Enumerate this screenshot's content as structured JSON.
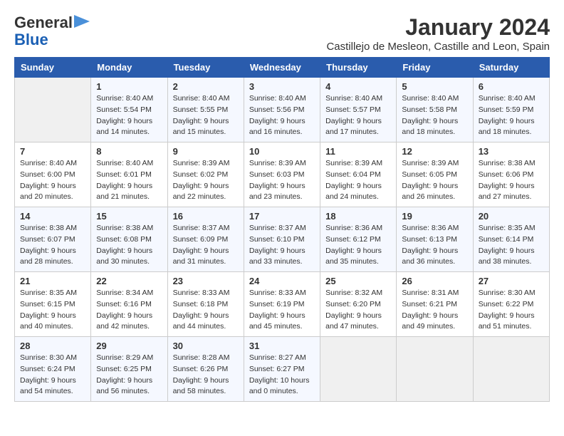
{
  "logo": {
    "line1": "General",
    "line2": "Blue"
  },
  "title": "January 2024",
  "subtitle": "Castillejo de Mesleon, Castille and Leon, Spain",
  "days_header": [
    "Sunday",
    "Monday",
    "Tuesday",
    "Wednesday",
    "Thursday",
    "Friday",
    "Saturday"
  ],
  "weeks": [
    [
      {
        "day": "",
        "sunrise": "",
        "sunset": "",
        "daylight": ""
      },
      {
        "day": "1",
        "sunrise": "Sunrise: 8:40 AM",
        "sunset": "Sunset: 5:54 PM",
        "daylight": "Daylight: 9 hours and 14 minutes."
      },
      {
        "day": "2",
        "sunrise": "Sunrise: 8:40 AM",
        "sunset": "Sunset: 5:55 PM",
        "daylight": "Daylight: 9 hours and 15 minutes."
      },
      {
        "day": "3",
        "sunrise": "Sunrise: 8:40 AM",
        "sunset": "Sunset: 5:56 PM",
        "daylight": "Daylight: 9 hours and 16 minutes."
      },
      {
        "day": "4",
        "sunrise": "Sunrise: 8:40 AM",
        "sunset": "Sunset: 5:57 PM",
        "daylight": "Daylight: 9 hours and 17 minutes."
      },
      {
        "day": "5",
        "sunrise": "Sunrise: 8:40 AM",
        "sunset": "Sunset: 5:58 PM",
        "daylight": "Daylight: 9 hours and 18 minutes."
      },
      {
        "day": "6",
        "sunrise": "Sunrise: 8:40 AM",
        "sunset": "Sunset: 5:59 PM",
        "daylight": "Daylight: 9 hours and 18 minutes."
      }
    ],
    [
      {
        "day": "7",
        "sunrise": "Sunrise: 8:40 AM",
        "sunset": "Sunset: 6:00 PM",
        "daylight": "Daylight: 9 hours and 20 minutes."
      },
      {
        "day": "8",
        "sunrise": "Sunrise: 8:40 AM",
        "sunset": "Sunset: 6:01 PM",
        "daylight": "Daylight: 9 hours and 21 minutes."
      },
      {
        "day": "9",
        "sunrise": "Sunrise: 8:39 AM",
        "sunset": "Sunset: 6:02 PM",
        "daylight": "Daylight: 9 hours and 22 minutes."
      },
      {
        "day": "10",
        "sunrise": "Sunrise: 8:39 AM",
        "sunset": "Sunset: 6:03 PM",
        "daylight": "Daylight: 9 hours and 23 minutes."
      },
      {
        "day": "11",
        "sunrise": "Sunrise: 8:39 AM",
        "sunset": "Sunset: 6:04 PM",
        "daylight": "Daylight: 9 hours and 24 minutes."
      },
      {
        "day": "12",
        "sunrise": "Sunrise: 8:39 AM",
        "sunset": "Sunset: 6:05 PM",
        "daylight": "Daylight: 9 hours and 26 minutes."
      },
      {
        "day": "13",
        "sunrise": "Sunrise: 8:38 AM",
        "sunset": "Sunset: 6:06 PM",
        "daylight": "Daylight: 9 hours and 27 minutes."
      }
    ],
    [
      {
        "day": "14",
        "sunrise": "Sunrise: 8:38 AM",
        "sunset": "Sunset: 6:07 PM",
        "daylight": "Daylight: 9 hours and 28 minutes."
      },
      {
        "day": "15",
        "sunrise": "Sunrise: 8:38 AM",
        "sunset": "Sunset: 6:08 PM",
        "daylight": "Daylight: 9 hours and 30 minutes."
      },
      {
        "day": "16",
        "sunrise": "Sunrise: 8:37 AM",
        "sunset": "Sunset: 6:09 PM",
        "daylight": "Daylight: 9 hours and 31 minutes."
      },
      {
        "day": "17",
        "sunrise": "Sunrise: 8:37 AM",
        "sunset": "Sunset: 6:10 PM",
        "daylight": "Daylight: 9 hours and 33 minutes."
      },
      {
        "day": "18",
        "sunrise": "Sunrise: 8:36 AM",
        "sunset": "Sunset: 6:12 PM",
        "daylight": "Daylight: 9 hours and 35 minutes."
      },
      {
        "day": "19",
        "sunrise": "Sunrise: 8:36 AM",
        "sunset": "Sunset: 6:13 PM",
        "daylight": "Daylight: 9 hours and 36 minutes."
      },
      {
        "day": "20",
        "sunrise": "Sunrise: 8:35 AM",
        "sunset": "Sunset: 6:14 PM",
        "daylight": "Daylight: 9 hours and 38 minutes."
      }
    ],
    [
      {
        "day": "21",
        "sunrise": "Sunrise: 8:35 AM",
        "sunset": "Sunset: 6:15 PM",
        "daylight": "Daylight: 9 hours and 40 minutes."
      },
      {
        "day": "22",
        "sunrise": "Sunrise: 8:34 AM",
        "sunset": "Sunset: 6:16 PM",
        "daylight": "Daylight: 9 hours and 42 minutes."
      },
      {
        "day": "23",
        "sunrise": "Sunrise: 8:33 AM",
        "sunset": "Sunset: 6:18 PM",
        "daylight": "Daylight: 9 hours and 44 minutes."
      },
      {
        "day": "24",
        "sunrise": "Sunrise: 8:33 AM",
        "sunset": "Sunset: 6:19 PM",
        "daylight": "Daylight: 9 hours and 45 minutes."
      },
      {
        "day": "25",
        "sunrise": "Sunrise: 8:32 AM",
        "sunset": "Sunset: 6:20 PM",
        "daylight": "Daylight: 9 hours and 47 minutes."
      },
      {
        "day": "26",
        "sunrise": "Sunrise: 8:31 AM",
        "sunset": "Sunset: 6:21 PM",
        "daylight": "Daylight: 9 hours and 49 minutes."
      },
      {
        "day": "27",
        "sunrise": "Sunrise: 8:30 AM",
        "sunset": "Sunset: 6:22 PM",
        "daylight": "Daylight: 9 hours and 51 minutes."
      }
    ],
    [
      {
        "day": "28",
        "sunrise": "Sunrise: 8:30 AM",
        "sunset": "Sunset: 6:24 PM",
        "daylight": "Daylight: 9 hours and 54 minutes."
      },
      {
        "day": "29",
        "sunrise": "Sunrise: 8:29 AM",
        "sunset": "Sunset: 6:25 PM",
        "daylight": "Daylight: 9 hours and 56 minutes."
      },
      {
        "day": "30",
        "sunrise": "Sunrise: 8:28 AM",
        "sunset": "Sunset: 6:26 PM",
        "daylight": "Daylight: 9 hours and 58 minutes."
      },
      {
        "day": "31",
        "sunrise": "Sunrise: 8:27 AM",
        "sunset": "Sunset: 6:27 PM",
        "daylight": "Daylight: 10 hours and 0 minutes."
      },
      {
        "day": "",
        "sunrise": "",
        "sunset": "",
        "daylight": ""
      },
      {
        "day": "",
        "sunrise": "",
        "sunset": "",
        "daylight": ""
      },
      {
        "day": "",
        "sunrise": "",
        "sunset": "",
        "daylight": ""
      }
    ]
  ]
}
